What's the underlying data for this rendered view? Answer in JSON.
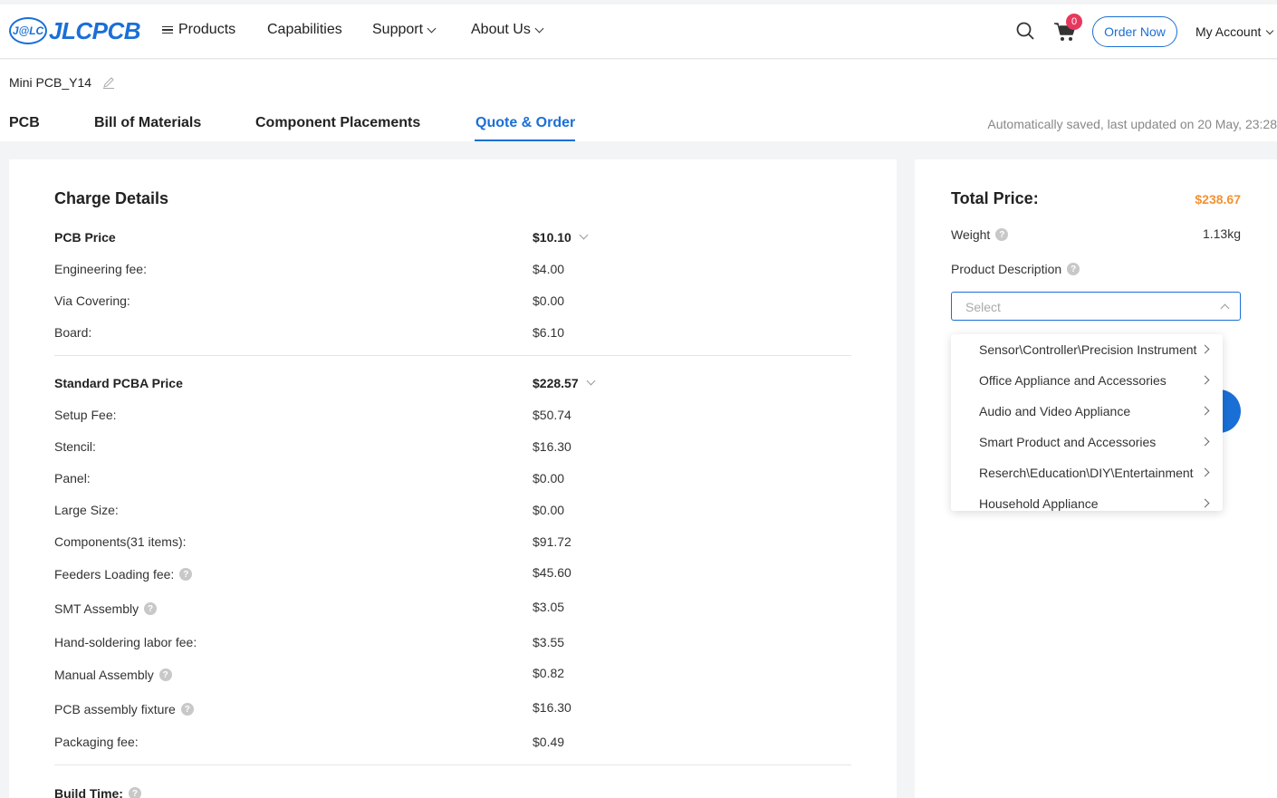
{
  "header": {
    "logo_badge": "J@LC",
    "logo_text": "JLCPCB",
    "nav": [
      {
        "label": "Products"
      },
      {
        "label": "Capabilities"
      },
      {
        "label": "Support"
      },
      {
        "label": "About Us"
      }
    ],
    "cart_count": "0",
    "order_now": "Order Now",
    "account": "My Account"
  },
  "project": {
    "name": "Mini PCB_Y14",
    "tabs": [
      "PCB",
      "Bill of Materials",
      "Component Placements",
      "Quote & Order"
    ],
    "active_tab": "Quote & Order",
    "saved_text": "Automatically saved, last updated on 20 May, 23:28"
  },
  "charges": {
    "title": "Charge Details",
    "pcb": {
      "label": "PCB Price",
      "value": "$10.10",
      "items": [
        {
          "label": "Engineering fee:",
          "value": "$4.00"
        },
        {
          "label": "Via Covering:",
          "value": "$0.00"
        },
        {
          "label": "Board:",
          "value": "$6.10"
        }
      ]
    },
    "pcba": {
      "label": "Standard PCBA Price",
      "value": "$228.57",
      "items": [
        {
          "label": "Setup Fee:",
          "value": "$50.74"
        },
        {
          "label": "Stencil:",
          "value": "$16.30"
        },
        {
          "label": "Panel:",
          "value": "$0.00"
        },
        {
          "label": "Large Size:",
          "value": "$0.00"
        },
        {
          "label": "Components(31 items):",
          "value": "$91.72"
        },
        {
          "label": "Feeders Loading fee:",
          "value": "$45.60"
        },
        {
          "label": "SMT Assembly",
          "value": "$3.05"
        },
        {
          "label": "Hand-soldering labor fee:",
          "value": "$3.55"
        },
        {
          "label": "Manual Assembly",
          "value": "$0.82"
        },
        {
          "label": "PCB assembly fixture",
          "value": "$16.30"
        },
        {
          "label": "Packaging fee:",
          "value": "$0.49"
        }
      ]
    },
    "build_time": "Build Time:"
  },
  "summary": {
    "total_label": "Total Price:",
    "total_value": "$238.67",
    "weight_label": "Weight",
    "weight_value": "1.13kg",
    "product_description_label": "Product Description",
    "select_placeholder": "Select",
    "options": [
      "Sensor\\Controller\\Precision Instrument",
      "Office Appliance and Accessories",
      "Audio and Video Appliance",
      "Smart Product and Accessories",
      "Reserch\\Education\\DIY\\Entertainment",
      "Household Appliance"
    ]
  },
  "colors": {
    "brand_blue": "#1a6fd6",
    "price_orange": "#f39233",
    "badge_red": "#e8375d"
  },
  "icons": [
    "menu-icon",
    "search-icon",
    "cart-icon",
    "pencil-icon",
    "question-icon",
    "chevron-down-icon",
    "chevron-up-icon",
    "chevron-right-icon"
  ]
}
